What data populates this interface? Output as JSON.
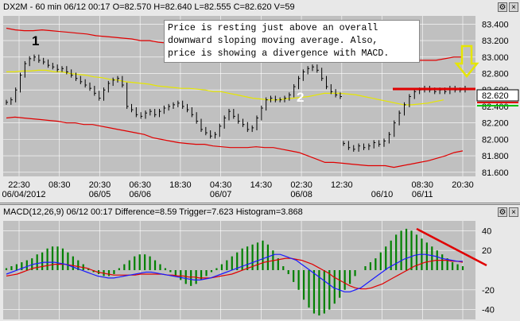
{
  "price_panel": {
    "header": "DX2M - 60 min 06/12 00:17 O=82.570 H=82.640 L=82.555 C=82.620 V=59",
    "current_price_label": "82.620",
    "annotation_lines": [
      "Price is resting just above an overall",
      "downward sloping moving average. Also,",
      "price is showing a divergence with MACD."
    ],
    "marker_1": "1",
    "marker_2": "2"
  },
  "macd_panel": {
    "header": "MACD(12,26,9) 06/12 00:17 Difference=8.59 Trigger=7.623 Histogram=3.868"
  },
  "colors": {
    "plot_bg": "#c0c0c0",
    "price": "#000000",
    "ma": "#e6e600",
    "bands": "#e00000",
    "macd": "#1a1aff",
    "trigger": "#e00000",
    "hist": "#008000",
    "grid": "#ffffff"
  },
  "chart_data": [
    {
      "type": "line",
      "title": "DX2M - 60 min",
      "x_tick_labels": [
        "22:30",
        "08:30",
        "20:30",
        "06:30",
        "18:30",
        "04:30",
        "14:30",
        "02:30",
        "12:30",
        "",
        "08:30",
        "20:30"
      ],
      "x_tick_sublabels": [
        "06/04/2012",
        "",
        "06/05",
        "06/06",
        "",
        "06/07",
        "",
        "06/08",
        "",
        "06/10",
        "06/11",
        ""
      ],
      "y_tick_labels": [
        "83.400",
        "83.200",
        "83.000",
        "82.800",
        "82.600",
        "82.400",
        "82.200",
        "82.000",
        "81.800",
        "81.600"
      ],
      "ylim": [
        81.55,
        83.5
      ],
      "series": [
        {
          "values": [
            82.45,
            82.48,
            82.6,
            82.78,
            82.92,
            82.98,
            83.0,
            82.96,
            82.94,
            82.9,
            82.88,
            82.85,
            82.86,
            82.82,
            82.78,
            82.74,
            82.7,
            82.66,
            82.62,
            82.56,
            82.5,
            82.6,
            82.68,
            82.72,
            82.74,
            82.66,
            82.4,
            82.36,
            82.3,
            82.28,
            82.32,
            82.34,
            82.3,
            82.34,
            82.38,
            82.4,
            82.42,
            82.44,
            82.4,
            82.36,
            82.3,
            82.22,
            82.12,
            82.08,
            82.04,
            82.06,
            82.16,
            82.26,
            82.34,
            82.28,
            82.22,
            82.18,
            82.12,
            82.14,
            82.26,
            82.38,
            82.48,
            82.5,
            82.48,
            82.48,
            82.5,
            82.54,
            82.64,
            82.74,
            82.82,
            82.86,
            82.88,
            82.84,
            82.74,
            82.64,
            82.58,
            82.54,
            82.52
          ],
          "gap_after": 72
        },
        {
          "values": [
            81.95,
            81.9,
            81.88,
            81.92,
            81.9,
            81.92,
            81.96,
            81.94,
            81.98,
            82.06,
            82.2,
            82.32,
            82.42,
            82.52,
            82.58,
            82.6,
            82.62,
            82.6,
            82.58,
            82.6,
            82.58,
            82.62,
            82.6,
            82.6,
            82.62
          ]
        }
      ],
      "moving_average": [
        82.82,
        82.82,
        82.83,
        82.83,
        82.84,
        82.84,
        82.82,
        82.82,
        82.8,
        82.79,
        82.78,
        82.76,
        82.75,
        82.73,
        82.72,
        82.7,
        82.69,
        82.68,
        82.67,
        82.65,
        82.64,
        82.63,
        82.62,
        82.62,
        82.61,
        82.6,
        82.58,
        82.58,
        82.56,
        82.54,
        82.52,
        82.5,
        82.49,
        82.48,
        82.48,
        82.49,
        82.5,
        82.51,
        82.52,
        82.54,
        82.56,
        82.56,
        82.56,
        82.55,
        82.54,
        82.52,
        82.5,
        82.48,
        82.46,
        82.44,
        82.42,
        82.42,
        82.43,
        82.44,
        82.46,
        82.48
      ],
      "upper_band": [
        83.35,
        83.33,
        83.32,
        83.32,
        83.33,
        83.32,
        83.31,
        83.3,
        83.29,
        83.28,
        83.26,
        83.25,
        83.24,
        83.23,
        83.22,
        83.2,
        83.2,
        83.18,
        83.17,
        83.16,
        83.15,
        83.13,
        83.12,
        83.12,
        83.12,
        83.11,
        83.1,
        83.1,
        83.1,
        83.1,
        83.08,
        83.08,
        83.06,
        83.03,
        83.02,
        83.0,
        82.99,
        82.98,
        82.98,
        82.98,
        82.97,
        82.98,
        82.98,
        82.98,
        82.98,
        82.97,
        82.96,
        82.96,
        82.96,
        82.98,
        83.0,
        83.0
      ],
      "lower_band": [
        82.26,
        82.27,
        82.26,
        82.25,
        82.24,
        82.23,
        82.22,
        82.2,
        82.2,
        82.18,
        82.18,
        82.16,
        82.14,
        82.12,
        82.1,
        82.08,
        82.06,
        82.02,
        82.0,
        81.98,
        81.96,
        81.95,
        81.94,
        81.94,
        81.92,
        81.91,
        81.9,
        81.9,
        81.9,
        81.91,
        81.9,
        81.9,
        81.88,
        81.86,
        81.84,
        81.8,
        81.76,
        81.72,
        81.72,
        81.71,
        81.7,
        81.69,
        81.68,
        81.68,
        81.68,
        81.66,
        81.68,
        81.7,
        81.72,
        81.74,
        81.77,
        81.8,
        81.84,
        81.86
      ]
    },
    {
      "type": "bar",
      "title": "MACD(12,26,9)",
      "y_tick_labels": [
        "40",
        "20",
        "-20",
        "-40"
      ],
      "ylim": [
        -50,
        50
      ],
      "histogram": [
        2,
        4,
        6,
        8,
        10,
        12,
        16,
        18,
        22,
        24,
        24,
        22,
        18,
        14,
        10,
        6,
        2,
        -2,
        -4,
        -6,
        -6,
        -4,
        2,
        6,
        10,
        14,
        16,
        16,
        14,
        10,
        6,
        2,
        -2,
        -6,
        -10,
        -14,
        -16,
        -14,
        -10,
        -6,
        -2,
        2,
        6,
        10,
        14,
        18,
        22,
        24,
        26,
        28,
        30,
        26,
        20,
        12,
        4,
        -4,
        -12,
        -20,
        -30,
        -38,
        -44,
        -46,
        -44,
        -40,
        -34,
        -28,
        -20,
        -14,
        -6,
        0,
        4,
        8,
        12,
        18,
        24,
        30,
        36,
        40,
        42,
        40,
        36,
        32,
        28,
        24,
        20,
        16,
        12,
        8,
        6,
        4
      ],
      "difference": [
        -4,
        -2,
        0,
        2,
        4,
        6,
        7,
        8,
        8,
        8,
        7,
        6,
        4,
        2,
        0,
        -2,
        -4,
        -6,
        -7,
        -8,
        -8,
        -7,
        -6,
        -5,
        -4,
        -3,
        -2,
        -2,
        -3,
        -4,
        -5,
        -6,
        -7,
        -8,
        -9,
        -10,
        -10,
        -9,
        -8,
        -6,
        -4,
        -2,
        0,
        2,
        4,
        6,
        8,
        10,
        12,
        14,
        16,
        16,
        14,
        12,
        10,
        6,
        2,
        -2,
        -6,
        -10,
        -14,
        -18,
        -20,
        -22,
        -22,
        -20,
        -18,
        -14,
        -10,
        -6,
        -2,
        2,
        5,
        8,
        11,
        13,
        15,
        16,
        16,
        15,
        14,
        12,
        11,
        10,
        9,
        9
      ],
      "trigger": [
        -6,
        -5,
        -4,
        -2,
        0,
        2,
        3,
        4,
        5,
        6,
        6,
        6,
        5,
        4,
        3,
        2,
        0,
        -2,
        -3,
        -4,
        -5,
        -5,
        -5,
        -5,
        -5,
        -4,
        -4,
        -4,
        -4,
        -4,
        -5,
        -5,
        -6,
        -6,
        -7,
        -7,
        -8,
        -8,
        -8,
        -7,
        -6,
        -5,
        -4,
        -2,
        0,
        2,
        4,
        6,
        8,
        9,
        10,
        11,
        12,
        12,
        11,
        10,
        8,
        6,
        3,
        0,
        -3,
        -7,
        -10,
        -13,
        -16,
        -18,
        -19,
        -19,
        -18,
        -16,
        -14,
        -11,
        -8,
        -5,
        -2,
        1,
        4,
        6,
        8,
        9,
        10,
        10,
        10,
        9,
        9,
        8
      ]
    }
  ]
}
